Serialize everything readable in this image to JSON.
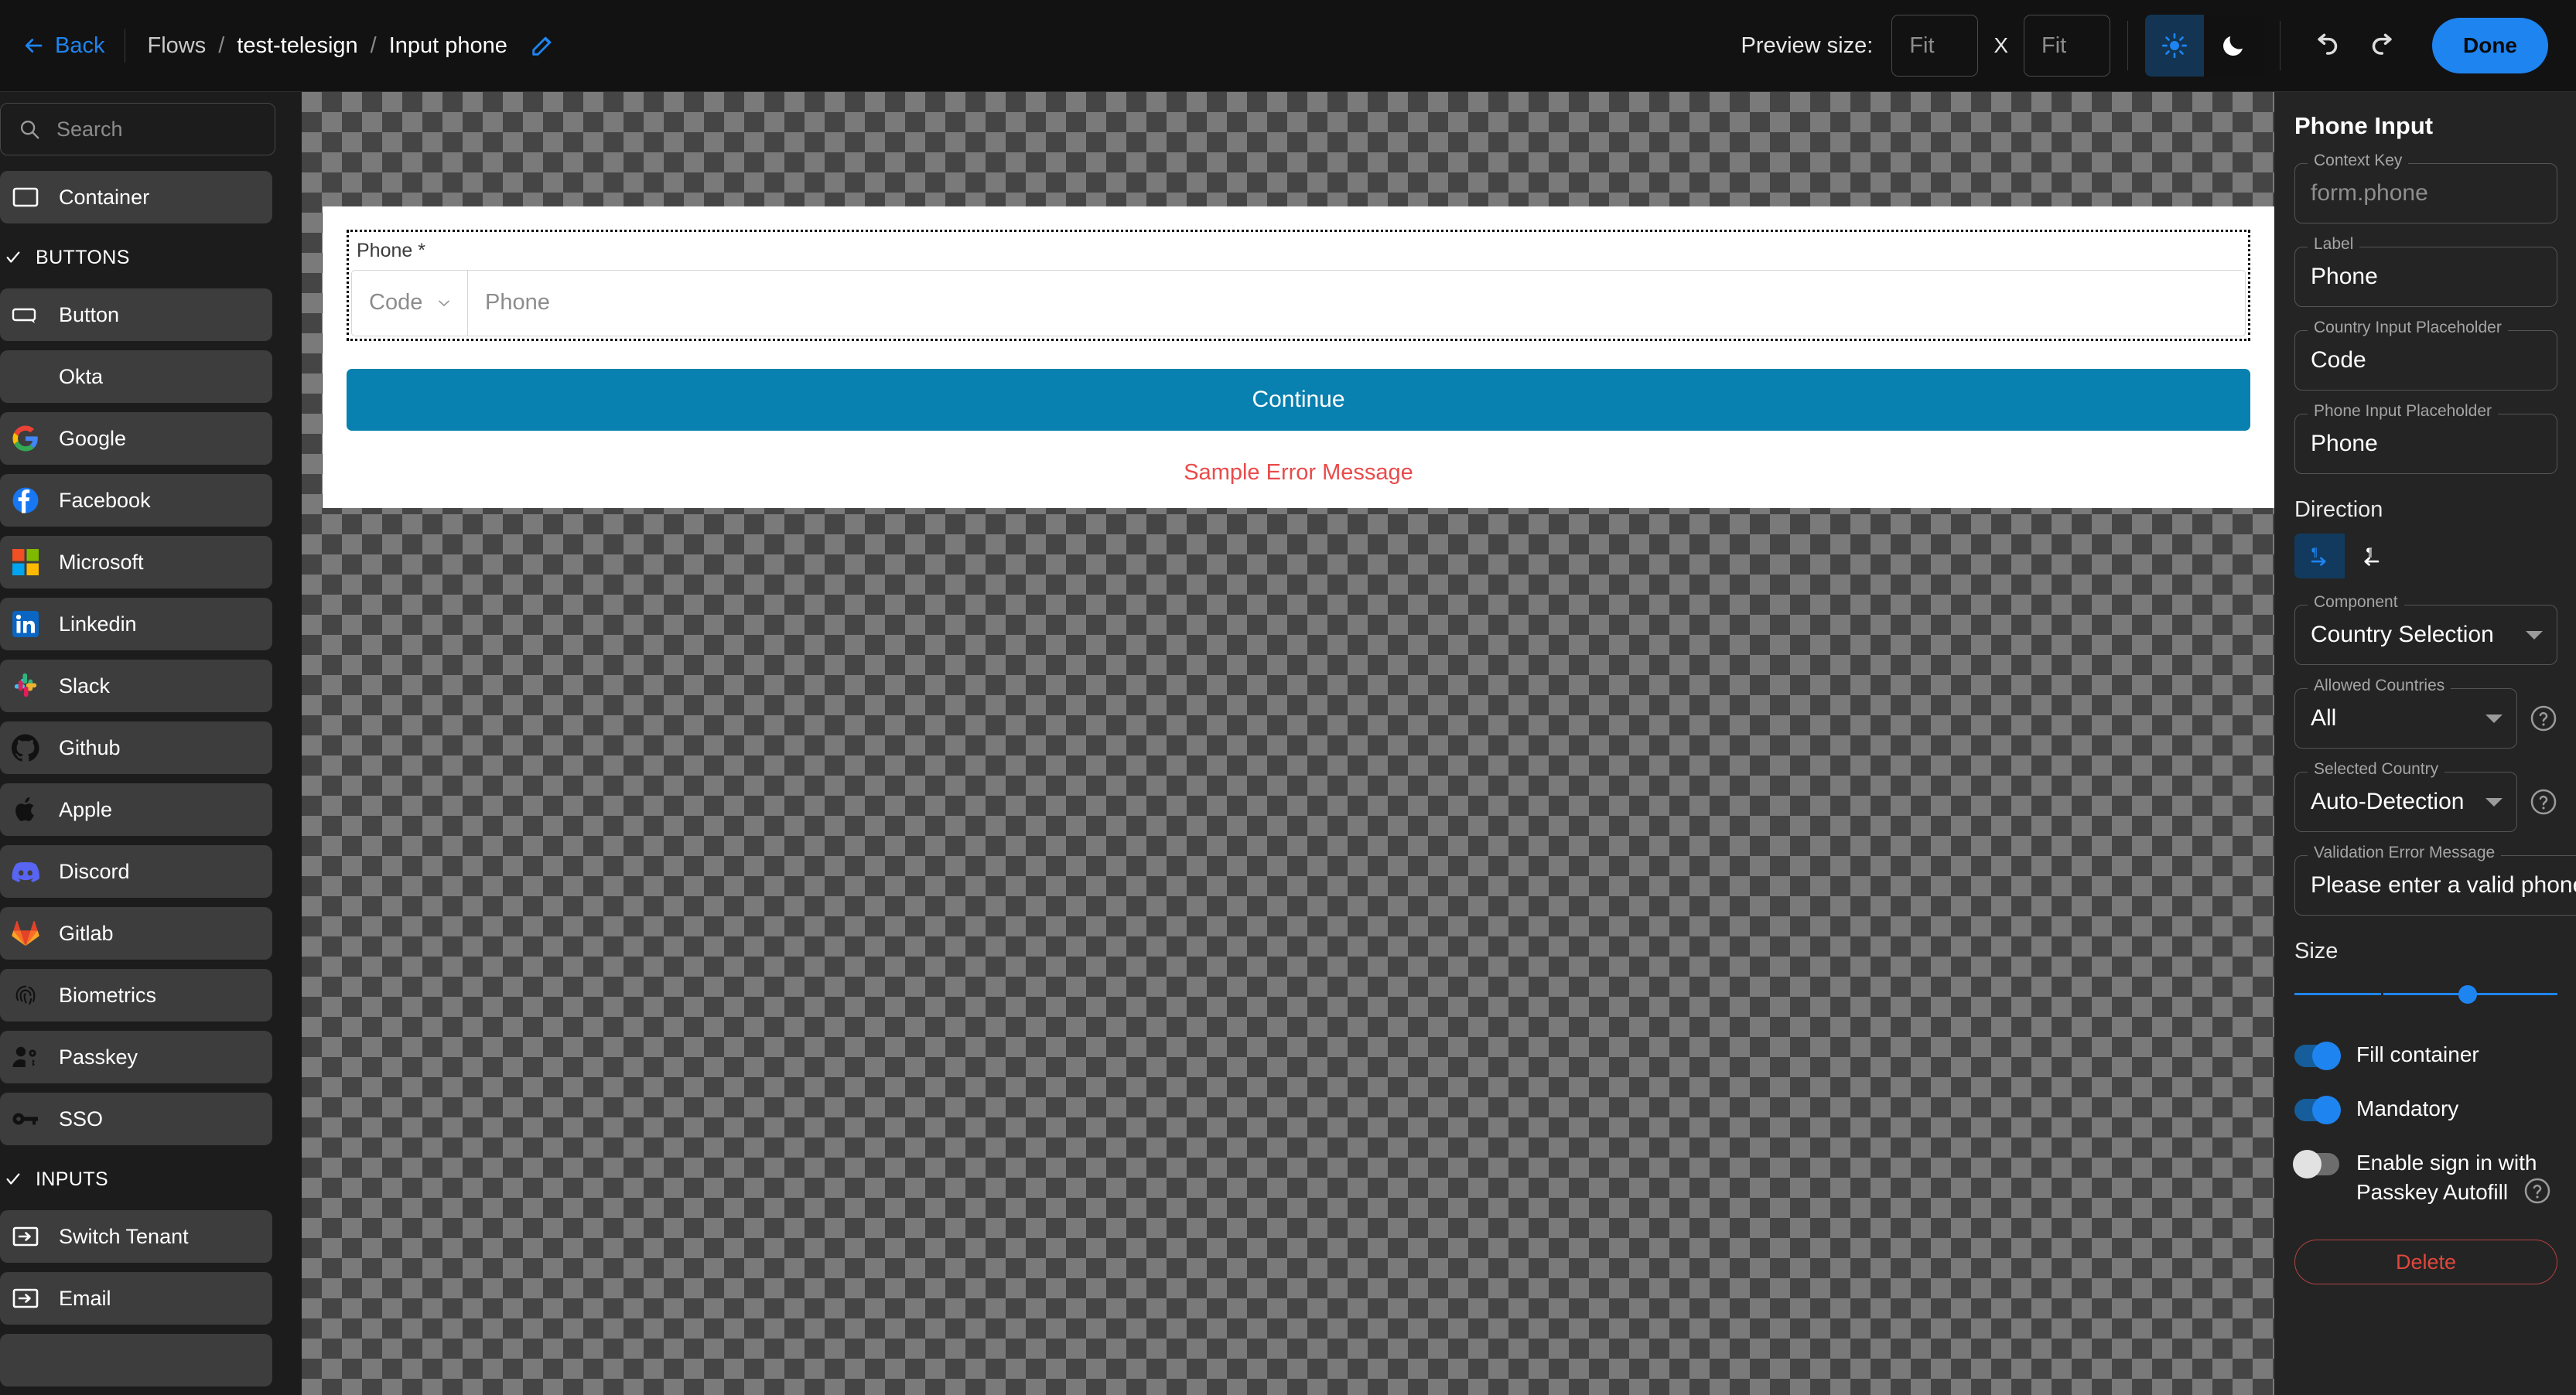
{
  "topbar": {
    "back_label": "Back",
    "breadcrumbs": [
      "Flows",
      "test-telesign",
      "Input phone"
    ],
    "separator": "/",
    "preview_size_label": "Preview size:",
    "preview_width": "Fit",
    "preview_height": "Fit",
    "size_separator": "X",
    "done_label": "Done",
    "accent_color": "#1e84f0"
  },
  "sidebar": {
    "search_placeholder": "Search",
    "items": [
      {
        "label": "Container",
        "icon": "container-icon",
        "type": "item"
      },
      {
        "label": "BUTTONS",
        "icon": "check-icon",
        "type": "group"
      },
      {
        "label": "Button",
        "icon": "button-icon",
        "type": "item"
      },
      {
        "label": "Okta",
        "icon": "okta-icon",
        "type": "item"
      },
      {
        "label": "Google",
        "icon": "google-icon",
        "type": "item"
      },
      {
        "label": "Facebook",
        "icon": "facebook-icon",
        "type": "item"
      },
      {
        "label": "Microsoft",
        "icon": "microsoft-icon",
        "type": "item"
      },
      {
        "label": "Linkedin",
        "icon": "linkedin-icon",
        "type": "item"
      },
      {
        "label": "Slack",
        "icon": "slack-icon",
        "type": "item"
      },
      {
        "label": "Github",
        "icon": "github-icon",
        "type": "item"
      },
      {
        "label": "Apple",
        "icon": "apple-icon",
        "type": "item"
      },
      {
        "label": "Discord",
        "icon": "discord-icon",
        "type": "item"
      },
      {
        "label": "Gitlab",
        "icon": "gitlab-icon",
        "type": "item"
      },
      {
        "label": "Biometrics",
        "icon": "fingerprint-icon",
        "type": "item"
      },
      {
        "label": "Passkey",
        "icon": "passkey-icon",
        "type": "item"
      },
      {
        "label": "SSO",
        "icon": "key-icon",
        "type": "item"
      },
      {
        "label": "INPUTS",
        "icon": "check-icon",
        "type": "group"
      },
      {
        "label": "Switch Tenant",
        "icon": "input-icon",
        "type": "item"
      },
      {
        "label": "Email",
        "icon": "input-icon",
        "type": "item"
      }
    ]
  },
  "preview": {
    "field_label": "Phone *",
    "country_placeholder": "Code",
    "phone_placeholder": "Phone",
    "continue_label": "Continue",
    "error_message": "Sample Error Message",
    "button_color": "#0880b0",
    "error_color": "#e94b4b"
  },
  "properties": {
    "title": "Phone Input",
    "fields": [
      {
        "label": "Context Key",
        "value": "form.phone",
        "dim": true
      },
      {
        "label": "Label",
        "value": "Phone",
        "dim": false
      },
      {
        "label": "Country Input Placeholder",
        "value": "Code",
        "dim": false
      },
      {
        "label": "Phone Input Placeholder",
        "value": "Phone",
        "dim": false
      }
    ],
    "direction": {
      "label": "Direction",
      "selected": "ltr",
      "options": [
        "ltr",
        "rtl"
      ]
    },
    "component": {
      "label": "Component",
      "value": "Country Selection"
    },
    "allowed_countries": {
      "label": "Allowed Countries",
      "value": "All"
    },
    "selected_country": {
      "label": "Selected Country",
      "value": "Auto-Detection"
    },
    "validation_error": {
      "label": "Validation Error Message",
      "value": "Please enter a valid phone"
    },
    "size": {
      "label": "Size",
      "percent": 66
    },
    "toggles": [
      {
        "label": "Fill container",
        "on": true
      },
      {
        "label": "Mandatory",
        "on": true
      }
    ],
    "passkey_toggle": {
      "line1": "Enable sign in with",
      "line2": "Passkey Autofill",
      "on": false
    },
    "delete_label": "Delete"
  }
}
